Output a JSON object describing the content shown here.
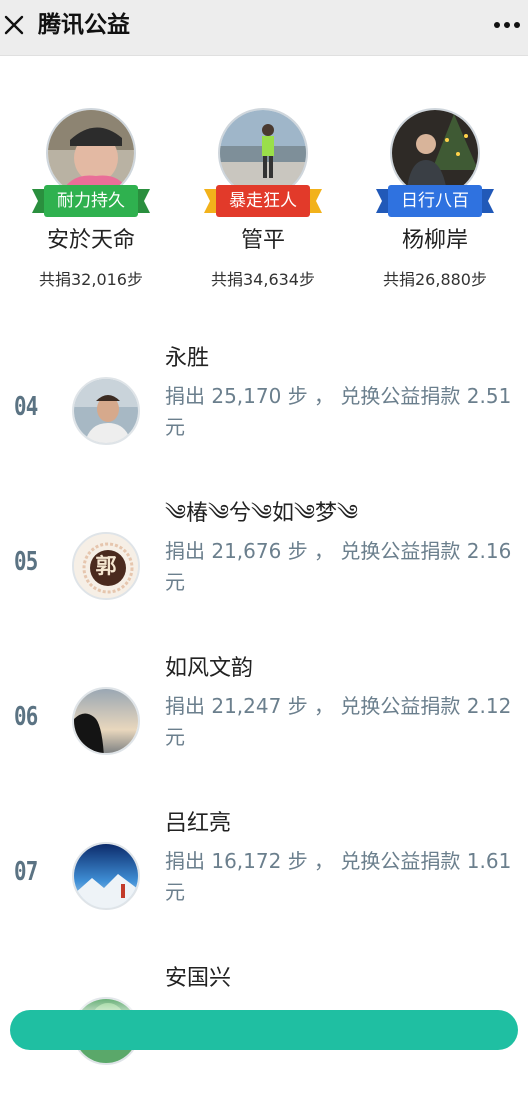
{
  "header": {
    "title": "腾讯公益",
    "close_icon": "close-icon",
    "more_icon": "more-icon"
  },
  "top3": [
    {
      "name": "安於天命",
      "badge": "耐力持久",
      "steps": "共捐32,016步",
      "badge_color": "#2fb14f",
      "avatar": "avatar-person-pink-shirt"
    },
    {
      "name": "管平",
      "badge": "暴走狂人",
      "steps": "共捐34,634步",
      "badge_color": "#e23a2a",
      "avatar": "avatar-runner"
    },
    {
      "name": "杨柳岸",
      "badge": "日行八百",
      "steps": "共捐26,880步",
      "badge_color": "#2f72e0",
      "avatar": "avatar-christmas-tree"
    }
  ],
  "list": [
    {
      "rank": "04",
      "name": "永胜",
      "desc": "捐出 25,170 步 ， 兑换公益捐款 2.51 元"
    },
    {
      "rank": "05",
      "name": "༄椿༄兮༄如༄梦༄",
      "desc": "捐出 21,676 步 ， 兑换公益捐款 2.16 元",
      "avatar_char": "郭"
    },
    {
      "rank": "06",
      "name": "如风文韵",
      "desc": "捐出 21,247 步 ， 兑换公益捐款 2.12 元"
    },
    {
      "rank": "07",
      "name": "吕红亮",
      "desc": "捐出 16,172 步 ， 兑换公益捐款 1.61 元"
    },
    {
      "rank": "",
      "name": "安国兴",
      "desc": ""
    }
  ],
  "colors": {
    "rank": "#5b7383",
    "desc": "#6b7f8d",
    "accent": "#1fbfa2"
  }
}
